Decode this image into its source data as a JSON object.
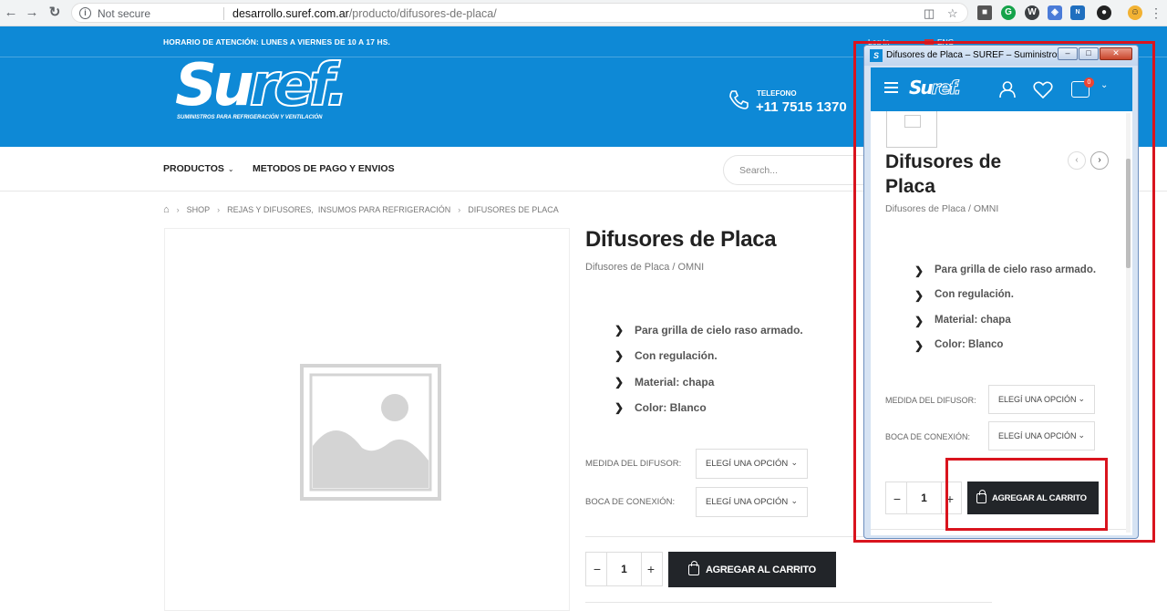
{
  "browser": {
    "security_label": "Not secure",
    "url_domain": "desarrollo.suref.com.ar",
    "url_path": "/producto/difusores-de-placa/"
  },
  "topbar": {
    "hours": "HORARIO DE ATENCIÓN: LUNES A VIERNES DE 10 A 17 HS.",
    "login": "Log In",
    "language": "ENG"
  },
  "brand": {
    "logo_su": "Su",
    "logo_ref": "ref.",
    "tagline": "SUMINISTROS PARA REFRIGERACIÓN Y VENTILACIÓN",
    "accent_color": "#0e89d6"
  },
  "phone": {
    "label": "TELEFONO",
    "number": "+11 7515 1370"
  },
  "nav": {
    "products": "PRODUCTOS",
    "payment": "METODOS DE PAGO Y ENVIOS",
    "search_placeholder": "Search..."
  },
  "breadcrumb": [
    "SHOP",
    "REJAS Y DIFUSORES,",
    "INSUMOS PARA REFRIGERACIÓN",
    "DIFUSORES DE PLACA"
  ],
  "product": {
    "title": "Difusores de Placa",
    "category": "Difusores de Placa / OMNI",
    "features": [
      "Para grilla de cielo raso armado.",
      "Con regulación.",
      "Material: chapa",
      "Color: Blanco"
    ],
    "variation_1_label": "MEDIDA DEL DIFUSOR:",
    "variation_2_label": "BOCA DE CONEXIÓN:",
    "select_placeholder": "ELEGÍ UNA OPCIÓN",
    "quantity": "1",
    "add_to_cart": "AGREGAR AL CARRITO",
    "minus": "−",
    "plus": "+"
  },
  "popup": {
    "window_title": "Difusores de Placa – SUREF – Suministros...",
    "title_line1": "Difusores de",
    "title_line2": "Placa",
    "cart_count": "0",
    "logo_su": "Su",
    "logo_ref": "ref."
  }
}
